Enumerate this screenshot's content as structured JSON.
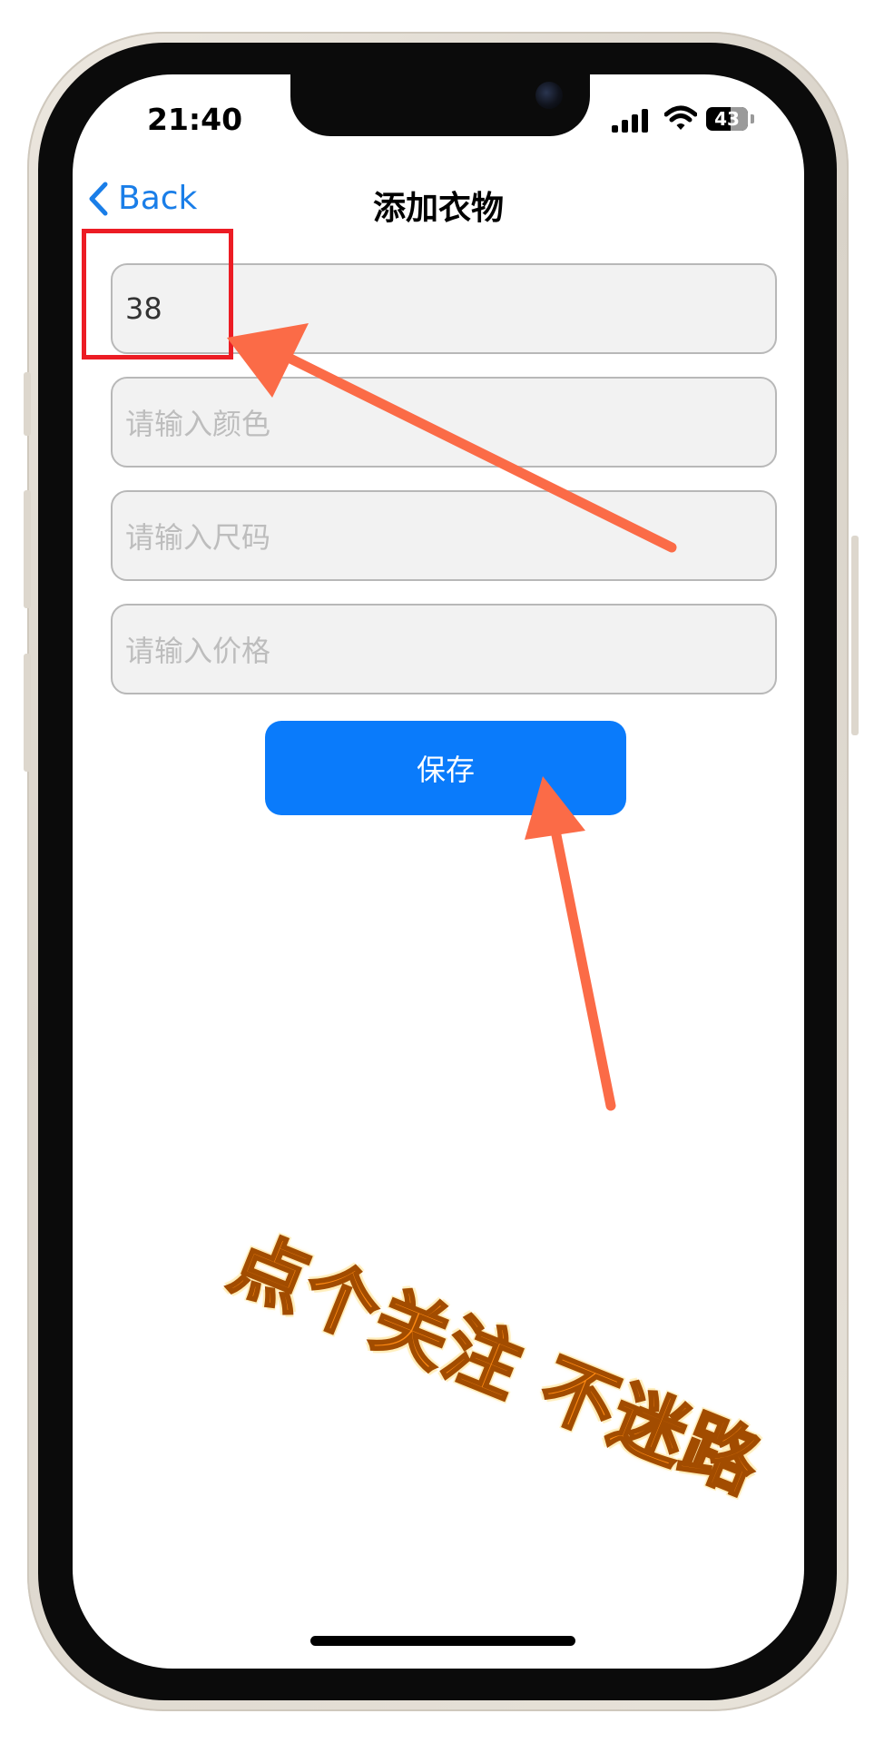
{
  "status_bar": {
    "time": "21:40",
    "battery": "43"
  },
  "nav": {
    "back_label": "Back",
    "title": "添加衣物"
  },
  "form": {
    "name_value": "38",
    "color_placeholder": "请输入颜色",
    "size_placeholder": "请输入尺码",
    "price_placeholder": "请输入价格",
    "save_label": "保存"
  },
  "overlay": {
    "follow_text": "点个关注  不迷路"
  },
  "colors": {
    "accent": "#0a7bfb",
    "back_link": "#1a7ee8",
    "annotation_arrow": "#fb6b47",
    "highlight_box": "#ec1c24",
    "overlay_text": "#ff8a12"
  }
}
